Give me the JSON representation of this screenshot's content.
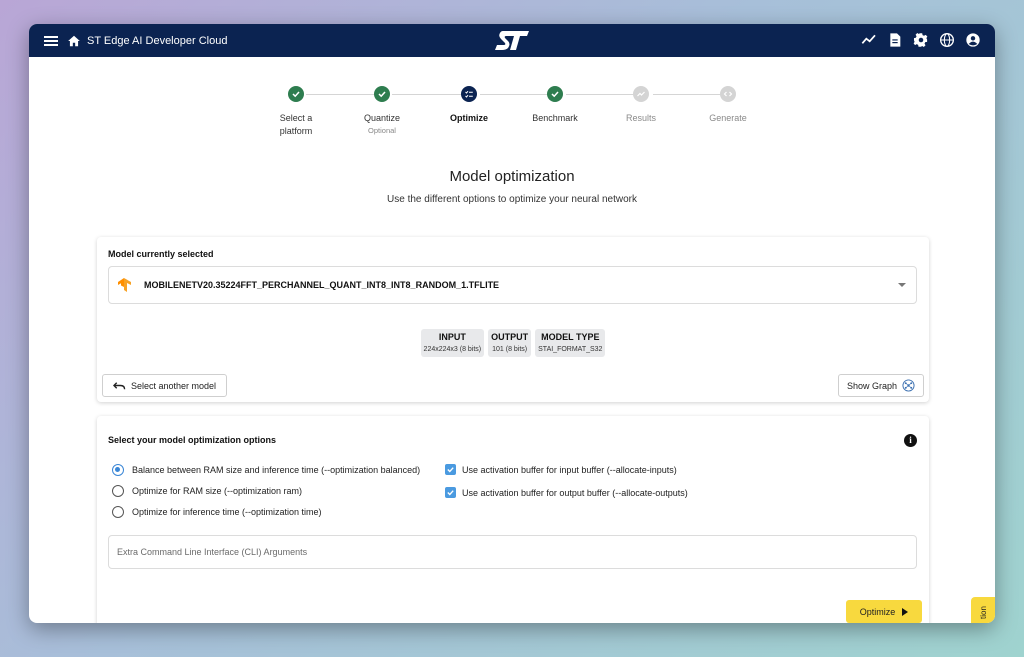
{
  "header": {
    "title": "ST Edge AI Developer Cloud",
    "icons": [
      "menu-icon",
      "home-icon",
      "st-logo",
      "chart-icon",
      "document-icon",
      "gear-icon",
      "globe-icon",
      "account-icon"
    ],
    "bar_color": "#0b2351"
  },
  "stepper": {
    "steps": [
      {
        "label": "Select a platform",
        "sub": "",
        "state": "done"
      },
      {
        "label": "Quantize",
        "sub": "Optional",
        "state": "done"
      },
      {
        "label": "Optimize",
        "sub": "",
        "state": "active"
      },
      {
        "label": "Benchmark",
        "sub": "",
        "state": "done"
      },
      {
        "label": "Results",
        "sub": "",
        "state": "disabled"
      },
      {
        "label": "Generate",
        "sub": "",
        "state": "disabled"
      }
    ],
    "colors": {
      "done": "#2e7d4f",
      "active": "#0b2351",
      "disabled": "#d4d4d4"
    }
  },
  "page": {
    "title": "Model optimization",
    "subtitle": "Use the different options to optimize your neural network"
  },
  "model_card": {
    "heading": "Model currently selected",
    "model_name": "MOBILENETV20.35224FFT_PERCHANNEL_QUANT_INT8_INT8_RANDOM_1.TFLITE",
    "info": [
      {
        "key": "INPUT",
        "value": "224x224x3 (8 bits)"
      },
      {
        "key": "OUTPUT",
        "value": "101 (8 bits)"
      },
      {
        "key": "MODEL TYPE",
        "value": "STAI_FORMAT_S32"
      }
    ],
    "select_another_label": "Select another model",
    "show_graph_label": "Show Graph"
  },
  "options_card": {
    "heading": "Select your model optimization options",
    "radios": [
      {
        "label": "Balance between RAM size and inference time (--optimization balanced)",
        "checked": true
      },
      {
        "label": "Optimize for RAM size (--optimization ram)",
        "checked": false
      },
      {
        "label": "Optimize for inference time (--optimization time)",
        "checked": false
      }
    ],
    "checkboxes": [
      {
        "label": "Use activation buffer for input buffer (--allocate-inputs)",
        "checked": true
      },
      {
        "label": "Use activation buffer for output buffer (--allocate-outputs)",
        "checked": true
      }
    ],
    "cli_placeholder": "Extra Command Line Interface (CLI) Arguments",
    "optimize_label": "Optimize",
    "accent_color": "#f8d93e"
  },
  "side_tab": {
    "label": "tion"
  }
}
